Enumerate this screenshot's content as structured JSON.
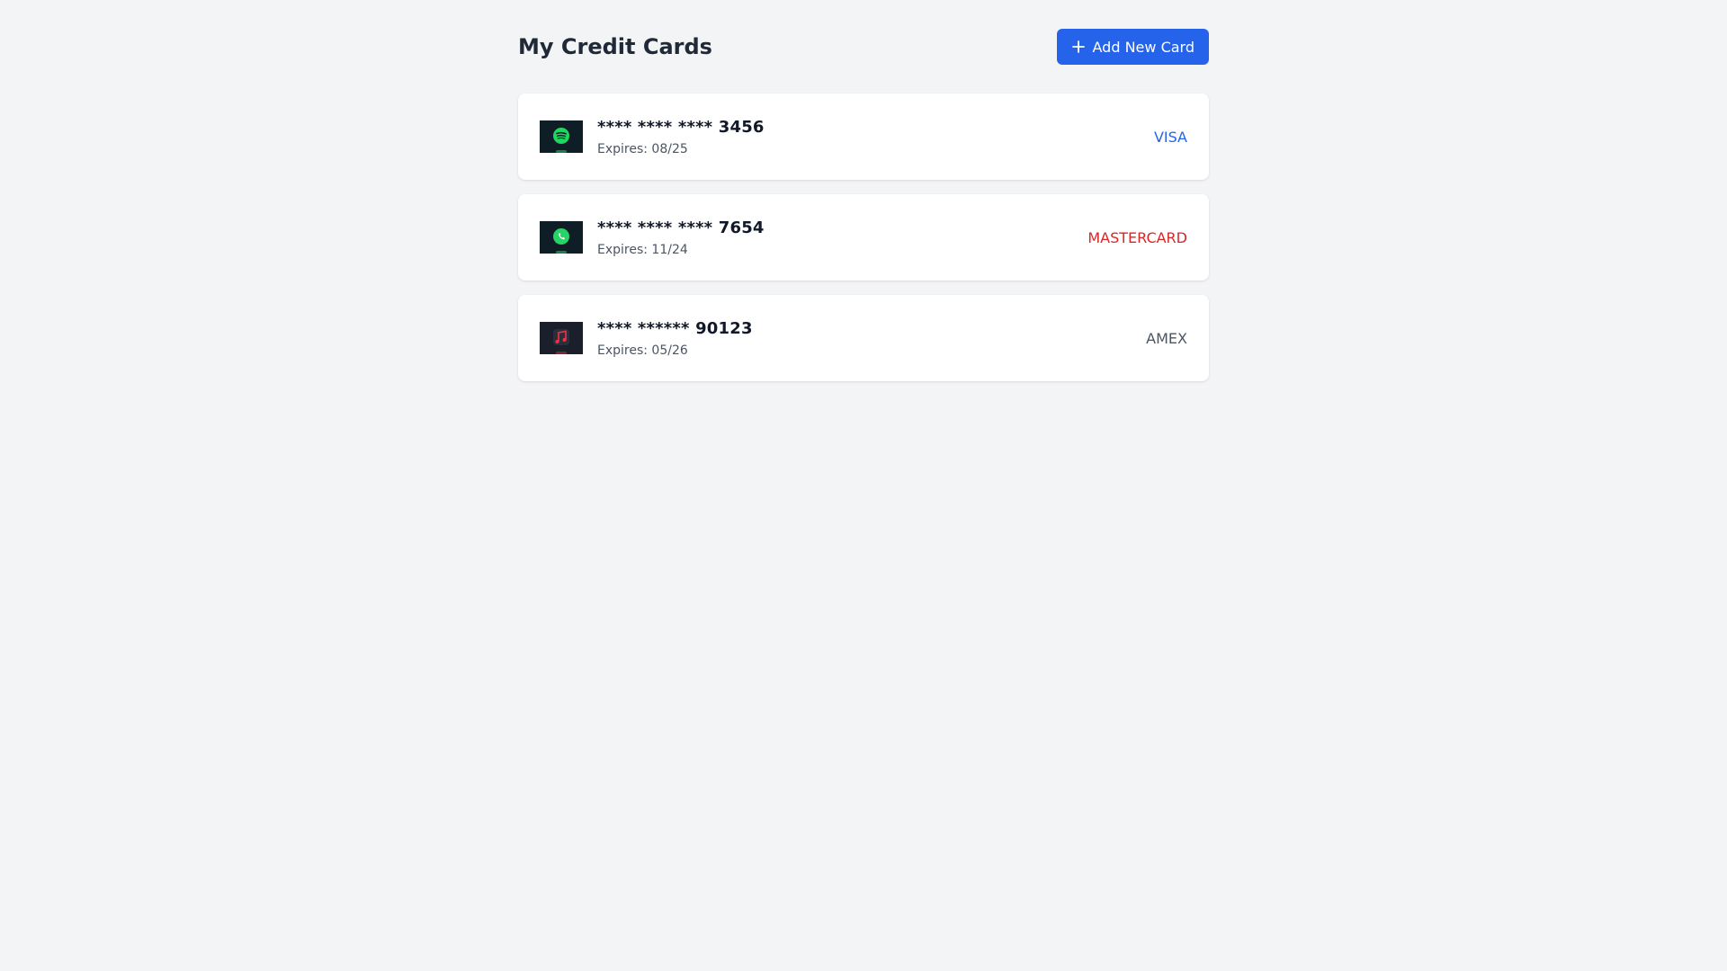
{
  "header": {
    "title": "My Credit Cards",
    "add_button_label": "Add New Card",
    "add_button_icon": "plus-icon"
  },
  "colors": {
    "page_background": "#f3f4f6",
    "primary": "#2563eb",
    "visa": "#2563eb",
    "mastercard": "#dc2626",
    "amex": "#4b5563"
  },
  "cards": [
    {
      "number": "**** **** **** 3456",
      "expiry": "Expires: 08/25",
      "brand": "VISA",
      "brand_color": "#2563eb",
      "thumbnail_icon": "spotify-icon"
    },
    {
      "number": "**** **** **** 7654",
      "expiry": "Expires: 11/24",
      "brand": "MASTERCARD",
      "brand_color": "#dc2626",
      "thumbnail_icon": "whatsapp-icon"
    },
    {
      "number": "**** ****** 90123",
      "expiry": "Expires: 05/26",
      "brand": "AMEX",
      "brand_color": "#4b5563",
      "thumbnail_icon": "music-note-icon"
    }
  ]
}
